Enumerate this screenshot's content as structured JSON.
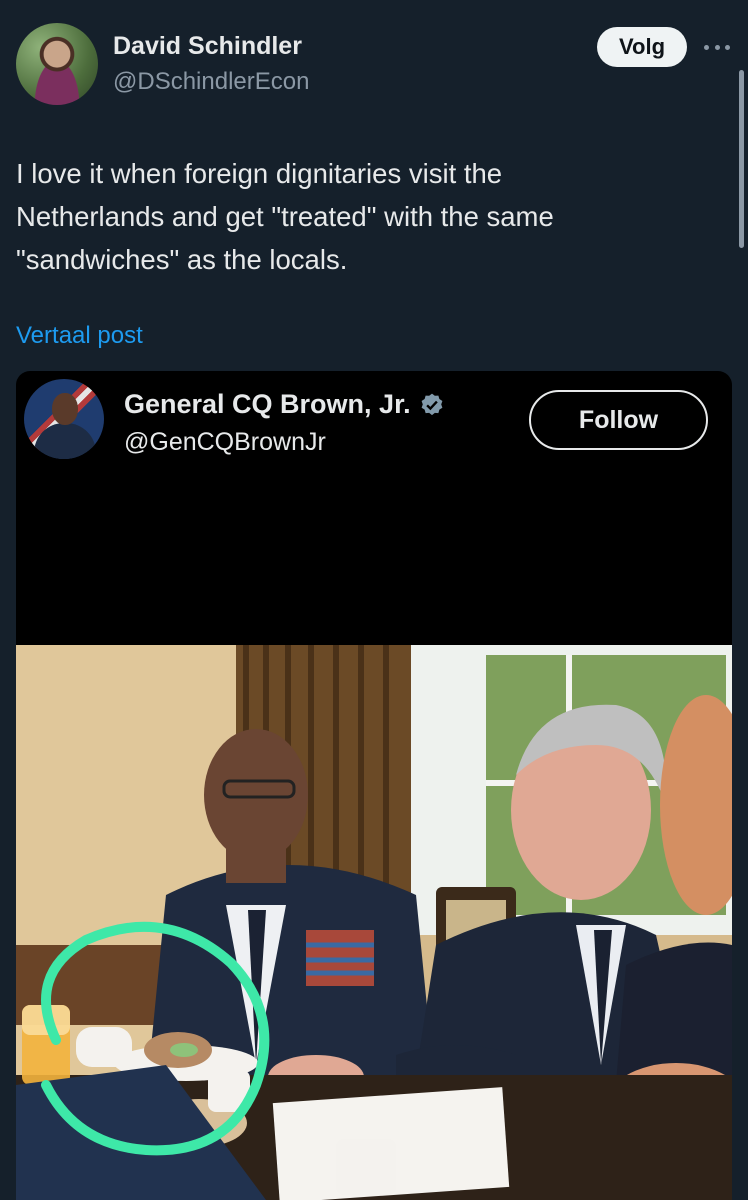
{
  "tweet": {
    "author_name": "David Schindler",
    "author_handle": "@DSchindlerEcon",
    "follow_label": "Volg",
    "text": "I love it when foreign dignitaries visit the\nNetherlands and get \"treated\" with the same\n\"sandwiches\" as the locals.",
    "translate_label": "Vertaal post"
  },
  "embedded": {
    "author_name": "General CQ Brown, Jr.",
    "author_handle": "@GenCQBrownJr",
    "follow_label": "Follow",
    "verified": true
  },
  "icons": {
    "more": "more-horizontal-icon",
    "verified": "verified-badge-icon"
  },
  "colors": {
    "background": "#15202b",
    "link": "#1d9bf0",
    "highlight_circle": "#3ee8a8"
  }
}
